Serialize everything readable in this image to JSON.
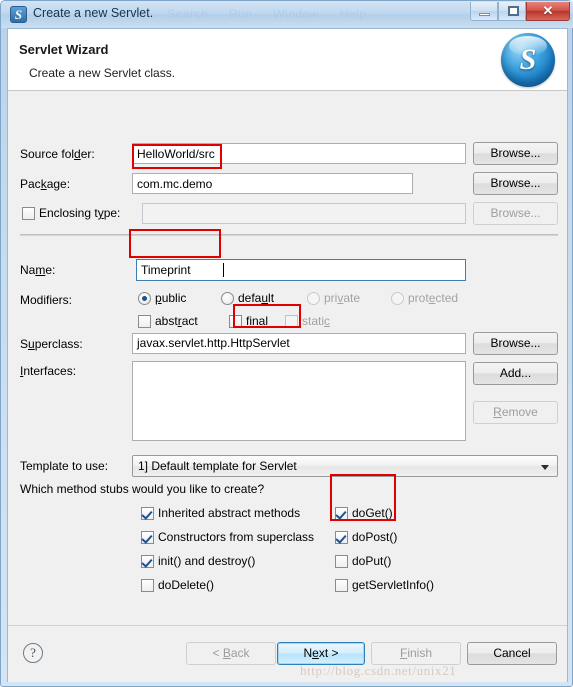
{
  "window": {
    "title": "Create a new Servlet.",
    "icon": "servlet-app-icon",
    "icon_glyph": "S",
    "ghost_menu": [
      "Search",
      "Run",
      "Window",
      "Help"
    ],
    "buttons": {
      "minimize": "minimize-button",
      "maximize": "maximize-button",
      "close_glyph": "✕"
    }
  },
  "header": {
    "title": "Servlet Wizard",
    "subtitle": "Create a new Servlet class.",
    "logo_glyph": "S"
  },
  "form": {
    "source_folder": {
      "label_pre": "Source fol",
      "label_mn": "d",
      "label_post": "er:",
      "value": "HelloWorld/src",
      "browse": "Browse..."
    },
    "package": {
      "label_pre": "Pac",
      "label_mn": "k",
      "label_post": "age:",
      "value": "com.mc.demo",
      "browse": "Browse..."
    },
    "enclosing_type": {
      "label_pre": "Enclosing t",
      "label_mn": "y",
      "label_post": "pe:",
      "value": "",
      "checked": false,
      "browse": "Browse..."
    },
    "name": {
      "label_pre": "Na",
      "label_mn": "m",
      "label_post": "e:",
      "value": "Timeprint"
    },
    "modifiers": {
      "label": "Modifiers:",
      "radios": [
        {
          "label_pre": "",
          "label_mn": "p",
          "label_post": "ublic",
          "checked": true,
          "disabled": false
        },
        {
          "label_pre": "defa",
          "label_mn": "u",
          "label_post": "lt",
          "checked": false,
          "disabled": false
        },
        {
          "label_pre": "pri",
          "label_mn": "v",
          "label_post": "ate",
          "checked": false,
          "disabled": true
        },
        {
          "label_pre": "prot",
          "label_mn": "e",
          "label_post": "cted",
          "checked": false,
          "disabled": true
        }
      ],
      "checks": [
        {
          "label_pre": "abst",
          "label_mn": "r",
          "label_post": "act",
          "checked": false,
          "disabled": false
        },
        {
          "label_pre": "fina",
          "label_mn": "l",
          "label_post": "",
          "checked": false,
          "disabled": false
        },
        {
          "label_pre": "stati",
          "label_mn": "c",
          "label_post": "",
          "checked": false,
          "disabled": true
        }
      ]
    },
    "superclass": {
      "label_pre": "S",
      "label_mn": "u",
      "label_post": "perclass:",
      "value": "javax.servlet.http.HttpServlet",
      "value_plain": "javax.servlet.http.",
      "value_highlight": "HttpServlet",
      "browse": "Browse..."
    },
    "interfaces": {
      "label_pre": "",
      "label_mn": "I",
      "label_post": "nterfaces:",
      "items": [],
      "add": "Add...",
      "remove_pre": "",
      "remove_mn": "R",
      "remove_post": "emove"
    },
    "template": {
      "label": "Template to use:",
      "selected": "1] Default template for Servlet"
    },
    "stubs": {
      "question": "Which method stubs would you like to create?",
      "left": [
        {
          "label": "Inherited abstract methods",
          "checked": true
        },
        {
          "label": "Constructors from superclass",
          "checked": true
        },
        {
          "label": "init() and destroy()",
          "checked": true
        },
        {
          "label": "doDelete()",
          "checked": false
        }
      ],
      "right": [
        {
          "label": "doGet()",
          "checked": true
        },
        {
          "label": "doPost()",
          "checked": true
        },
        {
          "label": "doPut()",
          "checked": false
        },
        {
          "label": "getServletInfo()",
          "checked": false
        }
      ]
    }
  },
  "footer": {
    "help": "?",
    "back_pre": "< ",
    "back_mn": "B",
    "back_post": "ack",
    "next_pre": "N",
    "next_mn": "e",
    "next_post": "xt >",
    "finish_pre": "",
    "finish_mn": "F",
    "finish_post": "inish",
    "cancel": "Cancel"
  },
  "watermark": "http://blog.csdn.net/unix21",
  "colors": {
    "annotation": "#e00000",
    "accent": "#2c7fb8",
    "titlebar": "#bfd7ee"
  }
}
